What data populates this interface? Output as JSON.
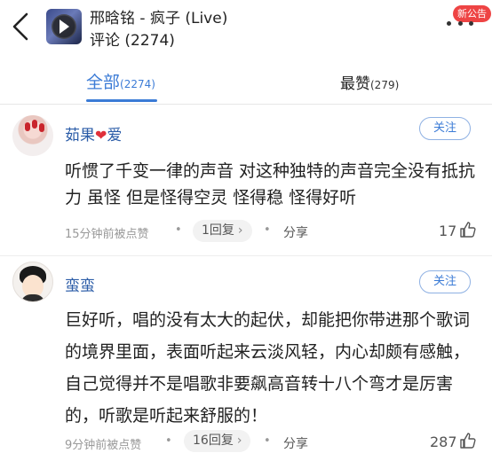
{
  "header": {
    "title": "邢晗铭 - 疯子 (Live)",
    "subtitle": "评论 (2274)",
    "notice_badge": "新公告"
  },
  "tabs": [
    {
      "label": "全部",
      "count": "(2274)",
      "active": true
    },
    {
      "label": "最赞",
      "count": "(279)",
      "active": false
    }
  ],
  "comments": [
    {
      "name": "茹果",
      "name_heart": "❤",
      "name_suffix": "爱",
      "follow_label": "关注",
      "text": "听惯了千变一律的声音 对这种独特的声音完全没有抵抗力 虽怪 但是怪得空灵 怪得稳 怪得好听",
      "time": "15分钟前被点赞",
      "replies": "1回复",
      "share_label": "分享",
      "likes": "17"
    },
    {
      "name": "蛮蛮",
      "follow_label": "关注",
      "text": "巨好听，唱的没有太大的起伏，却能把你带进那个歌词的境界里面，表面听起来云淡风轻，内心却颇有感触，自己觉得并不是唱歌非要飙高音转十八个弯才是厉害的，听歌是听起来舒服的！",
      "time": "9分钟前被点赞",
      "replies": "16回复",
      "share_label": "分享",
      "likes": "287"
    }
  ],
  "colors": {
    "accent": "#3b7bd6",
    "name": "#2c5da8",
    "badge": "#ee4444"
  }
}
